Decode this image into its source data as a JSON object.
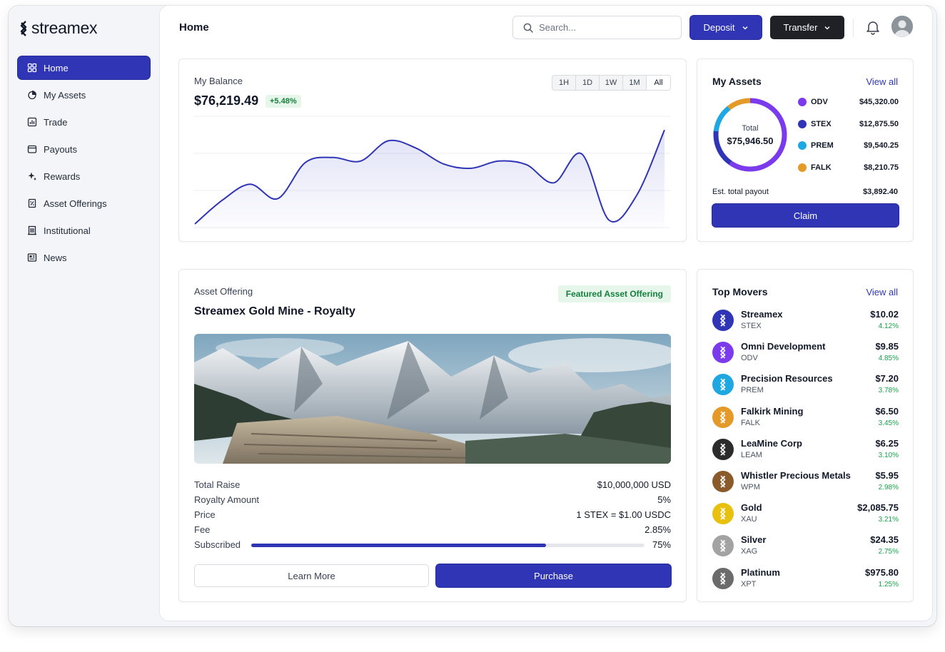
{
  "brand": {
    "name": "streamex"
  },
  "sidebar": {
    "items": [
      {
        "label": "Home",
        "icon": "grid-icon",
        "active": true
      },
      {
        "label": "My Assets",
        "icon": "pie-chart-icon"
      },
      {
        "label": "Trade",
        "icon": "bar-chart-icon"
      },
      {
        "label": "Payouts",
        "icon": "wallet-icon"
      },
      {
        "label": "Rewards",
        "icon": "sparkles-icon"
      },
      {
        "label": "Asset Offerings",
        "icon": "document-icon"
      },
      {
        "label": "Institutional",
        "icon": "building-icon"
      },
      {
        "label": "News",
        "icon": "newspaper-icon"
      }
    ]
  },
  "header": {
    "title": "Home",
    "search_placeholder": "Search...",
    "deposit_label": "Deposit",
    "transfer_label": "Transfer"
  },
  "balance": {
    "label": "My Balance",
    "amount": "$76,219.49",
    "change": "+5.48%",
    "ranges": [
      "1H",
      "1D",
      "1W",
      "1M",
      "All"
    ],
    "selected_range": "All",
    "accent": "#2f35b5"
  },
  "chart_data": {
    "type": "area",
    "series": [
      {
        "values": [
          5,
          38,
          60,
          40,
          90,
          97,
          92,
          120,
          110,
          88,
          82,
          92,
          87,
          62,
          102,
          10,
          45,
          135
        ]
      }
    ],
    "ylim": [
      0,
      150
    ],
    "grid": true
  },
  "assets": {
    "title": "My Assets",
    "view_all": "View all",
    "total_label": "Total",
    "total": "$75,946.50",
    "items": [
      {
        "symbol": "ODV",
        "value": "$45,320.00",
        "amount": 45320.0,
        "color": "#7c3aed"
      },
      {
        "symbol": "STEX",
        "value": "$12,875.50",
        "amount": 12875.5,
        "color": "#2f35b5"
      },
      {
        "symbol": "PREM",
        "value": "$9,540.25",
        "amount": 9540.25,
        "color": "#1ea7e1"
      },
      {
        "symbol": "FALK",
        "value": "$8,210.75",
        "amount": 8210.75,
        "color": "#e39a26"
      }
    ],
    "payout_label": "Est. total payout",
    "payout_value": "$3,892.40",
    "claim_label": "Claim"
  },
  "offering": {
    "label": "Asset Offering",
    "title": "Streamex Gold Mine - Royalty",
    "badge": "Featured Asset Offering",
    "details": [
      {
        "key": "Total Raise",
        "value": "$10,000,000 USD"
      },
      {
        "key": "Royalty Amount",
        "value": "5%"
      },
      {
        "key": "Price",
        "value": "1 STEX = $1.00 USDC"
      },
      {
        "key": "Fee",
        "value": "2.85%"
      }
    ],
    "subscribed_label": "Subscribed",
    "subscribed_value": "75%",
    "subscribed_fraction": 0.75,
    "learn_more": "Learn More",
    "purchase": "Purchase"
  },
  "movers": {
    "title": "Top Movers",
    "view_all": "View all",
    "items": [
      {
        "name": "Streamex",
        "symbol": "STEX",
        "price": "$10.02",
        "change": "4.12%",
        "color": "#2f35b5"
      },
      {
        "name": "Omni Development",
        "symbol": "ODV",
        "price": "$9.85",
        "change": "4.85%",
        "color": "#7c3aed"
      },
      {
        "name": "Precision Resources",
        "symbol": "PREM",
        "price": "$7.20",
        "change": "3.78%",
        "color": "#1ea7e1"
      },
      {
        "name": "Falkirk Mining",
        "symbol": "FALK",
        "price": "$6.50",
        "change": "3.45%",
        "color": "#e39a26"
      },
      {
        "name": "LeaMine Corp",
        "symbol": "LEAM",
        "price": "$6.25",
        "change": "3.10%",
        "color": "#2b2b2b"
      },
      {
        "name": "Whistler Precious Metals",
        "symbol": "WPM",
        "price": "$5.95",
        "change": "2.98%",
        "color": "#8a5a2b"
      },
      {
        "name": "Gold",
        "symbol": "XAU",
        "price": "$2,085.75",
        "change": "3.21%",
        "color": "#e8c10f"
      },
      {
        "name": "Silver",
        "symbol": "XAG",
        "price": "$24.35",
        "change": "2.75%",
        "color": "#a3a3a3"
      },
      {
        "name": "Platinum",
        "symbol": "XPT",
        "price": "$975.80",
        "change": "1.25%",
        "color": "#6b6b6b"
      }
    ]
  }
}
